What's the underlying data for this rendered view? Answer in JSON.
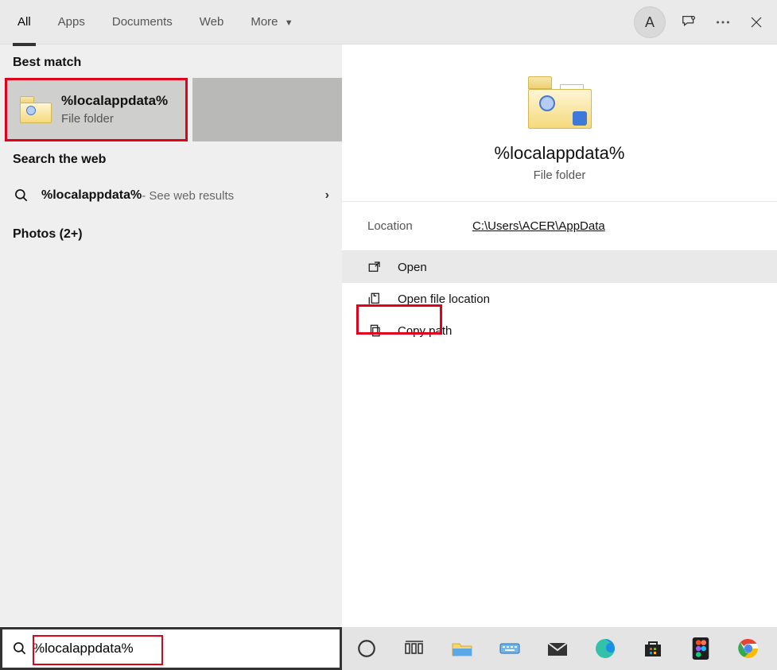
{
  "header": {
    "tabs": [
      "All",
      "Apps",
      "Documents",
      "Web",
      "More"
    ],
    "active_tab": 0,
    "avatar_letter": "A"
  },
  "left": {
    "best_match_heading": "Best match",
    "best_match": {
      "title": "%localappdata%",
      "subtitle": "File folder"
    },
    "web_heading": "Search the web",
    "web_result": {
      "query": "%localappdata%",
      "suffix": " - See web results"
    },
    "photos_heading": "Photos (2+)"
  },
  "details": {
    "title": "%localappdata%",
    "subtitle": "File folder",
    "location_label": "Location",
    "location_value": "C:\\Users\\ACER\\AppData",
    "actions": {
      "open": "Open",
      "open_location": "Open file location",
      "copy_path": "Copy path"
    }
  },
  "search": {
    "value": "%localappdata%"
  }
}
